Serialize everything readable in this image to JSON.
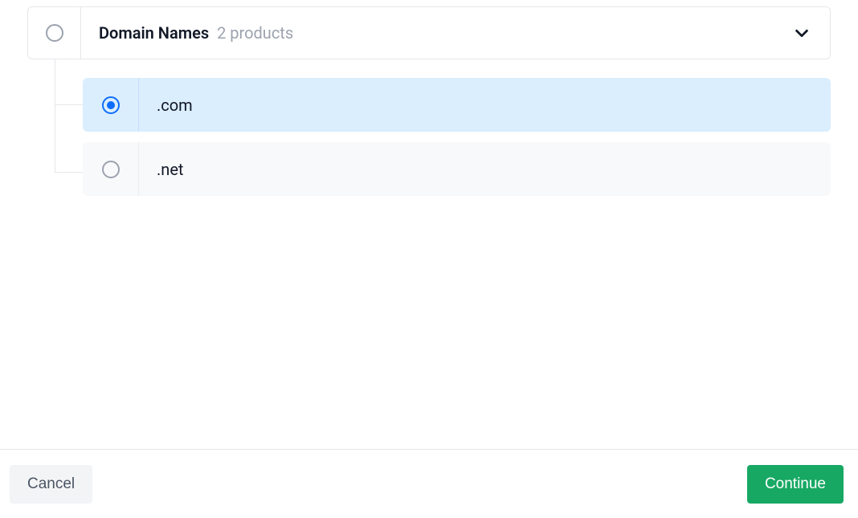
{
  "category": {
    "name": "Domain Names",
    "count_label": "2 products",
    "selected": false,
    "children": [
      {
        "label": ".com",
        "selected": true
      },
      {
        "label": ".net",
        "selected": false
      }
    ]
  },
  "footer": {
    "cancel_label": "Cancel",
    "continue_label": "Continue"
  }
}
